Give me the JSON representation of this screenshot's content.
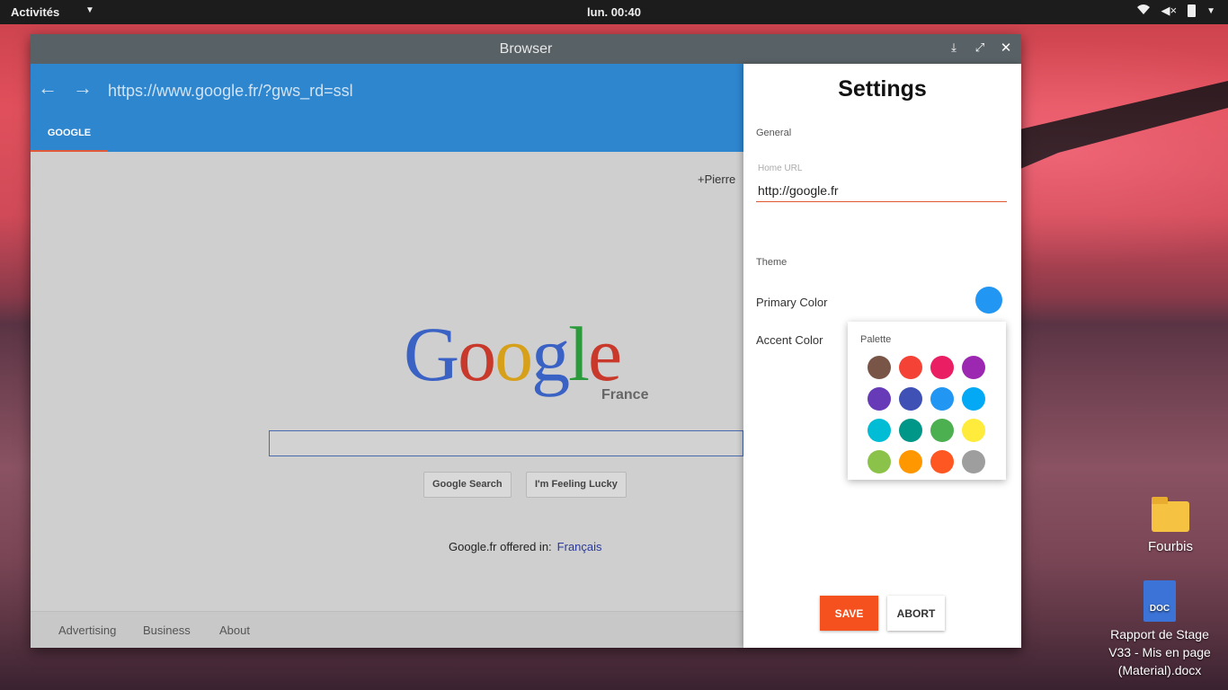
{
  "topbar": {
    "activities": "Activités",
    "clock": "lun. 00:40"
  },
  "window": {
    "title": "Browser",
    "controls": {
      "minimize": "⤓",
      "maximize": "⤢",
      "close": "✕"
    }
  },
  "browser": {
    "url": "https://www.google.fr/?gws_rd=ssl",
    "tab_label": "GOOGLE",
    "page": {
      "user_link": "+Pierre",
      "logo_letters": [
        "G",
        "o",
        "o",
        "g",
        "l",
        "e"
      ],
      "logo_sub": "France",
      "search_button": "Google Search",
      "lucky_button": "I'm Feeling Lucky",
      "offered_text": "Google.fr offered in:",
      "offered_lang": "Français",
      "footer": [
        "Advertising",
        "Business",
        "About"
      ]
    }
  },
  "settings": {
    "title": "Settings",
    "general_label": "General",
    "home_url_label": "Home URL",
    "home_url_value": "http://google.fr",
    "theme_label": "Theme",
    "primary_color_label": "Primary Color",
    "primary_color": "#2196f3",
    "accent_color_label": "Accent Color",
    "palette_title": "Palette",
    "palette": [
      "#795548",
      "#f44336",
      "#e91e63",
      "#9c27b0",
      "#673ab7",
      "#3f51b5",
      "#2196f3",
      "#03a9f4",
      "#00bcd4",
      "#009688",
      "#4caf50",
      "#ffeb3b",
      "#8bc34a",
      "#ff9800",
      "#ff5722",
      "#9e9e9e"
    ],
    "save_label": "SAVE",
    "abort_label": "ABORT"
  },
  "desktop": {
    "folder_name": "Fourbis",
    "doc_name_lines": [
      "Rapport de Stage",
      "V33 - Mis en page",
      "(Material).docx"
    ],
    "doc_badge": "DOC"
  }
}
